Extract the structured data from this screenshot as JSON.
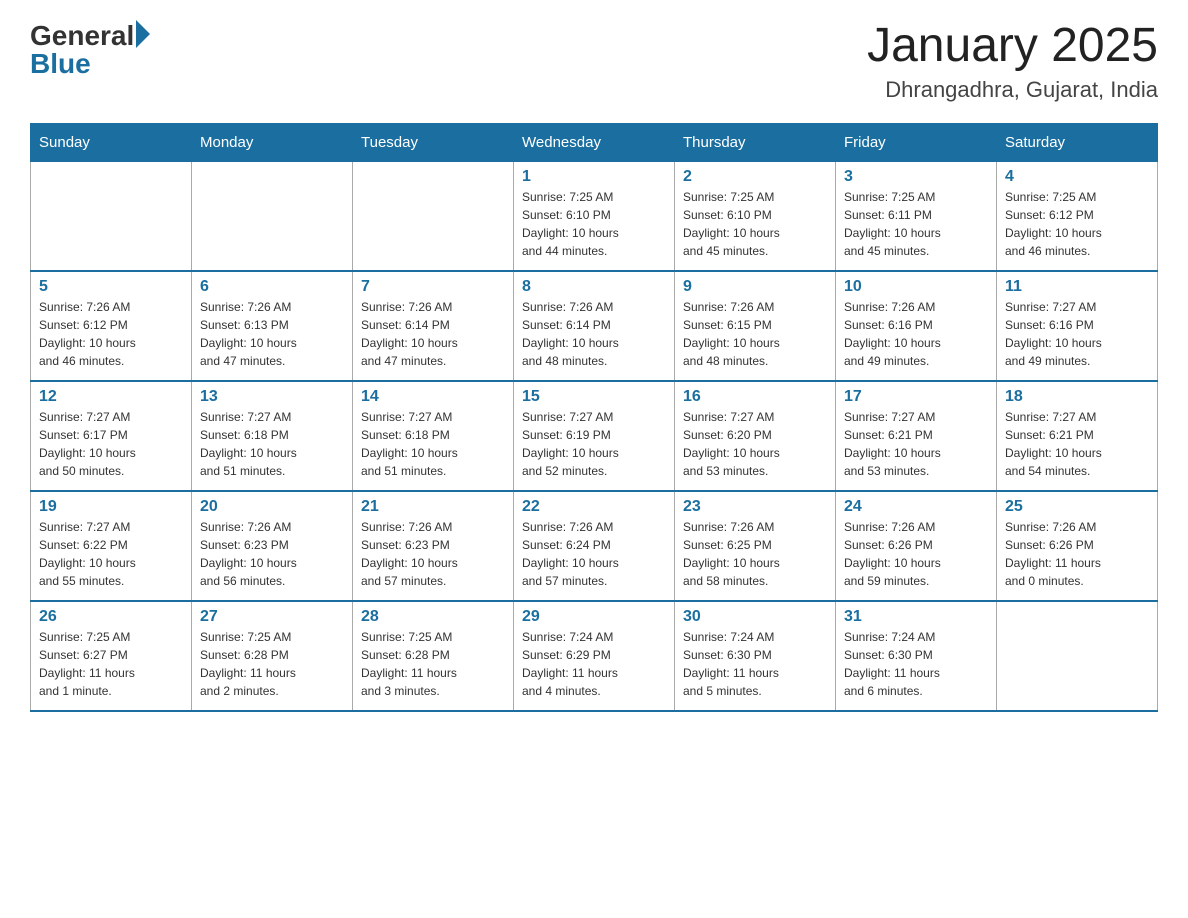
{
  "logo": {
    "general": "General",
    "blue": "Blue"
  },
  "title": "January 2025",
  "subtitle": "Dhrangadhra, Gujarat, India",
  "days_of_week": [
    "Sunday",
    "Monday",
    "Tuesday",
    "Wednesday",
    "Thursday",
    "Friday",
    "Saturday"
  ],
  "weeks": [
    [
      {
        "day": "",
        "info": ""
      },
      {
        "day": "",
        "info": ""
      },
      {
        "day": "",
        "info": ""
      },
      {
        "day": "1",
        "info": "Sunrise: 7:25 AM\nSunset: 6:10 PM\nDaylight: 10 hours\nand 44 minutes."
      },
      {
        "day": "2",
        "info": "Sunrise: 7:25 AM\nSunset: 6:10 PM\nDaylight: 10 hours\nand 45 minutes."
      },
      {
        "day": "3",
        "info": "Sunrise: 7:25 AM\nSunset: 6:11 PM\nDaylight: 10 hours\nand 45 minutes."
      },
      {
        "day": "4",
        "info": "Sunrise: 7:25 AM\nSunset: 6:12 PM\nDaylight: 10 hours\nand 46 minutes."
      }
    ],
    [
      {
        "day": "5",
        "info": "Sunrise: 7:26 AM\nSunset: 6:12 PM\nDaylight: 10 hours\nand 46 minutes."
      },
      {
        "day": "6",
        "info": "Sunrise: 7:26 AM\nSunset: 6:13 PM\nDaylight: 10 hours\nand 47 minutes."
      },
      {
        "day": "7",
        "info": "Sunrise: 7:26 AM\nSunset: 6:14 PM\nDaylight: 10 hours\nand 47 minutes."
      },
      {
        "day": "8",
        "info": "Sunrise: 7:26 AM\nSunset: 6:14 PM\nDaylight: 10 hours\nand 48 minutes."
      },
      {
        "day": "9",
        "info": "Sunrise: 7:26 AM\nSunset: 6:15 PM\nDaylight: 10 hours\nand 48 minutes."
      },
      {
        "day": "10",
        "info": "Sunrise: 7:26 AM\nSunset: 6:16 PM\nDaylight: 10 hours\nand 49 minutes."
      },
      {
        "day": "11",
        "info": "Sunrise: 7:27 AM\nSunset: 6:16 PM\nDaylight: 10 hours\nand 49 minutes."
      }
    ],
    [
      {
        "day": "12",
        "info": "Sunrise: 7:27 AM\nSunset: 6:17 PM\nDaylight: 10 hours\nand 50 minutes."
      },
      {
        "day": "13",
        "info": "Sunrise: 7:27 AM\nSunset: 6:18 PM\nDaylight: 10 hours\nand 51 minutes."
      },
      {
        "day": "14",
        "info": "Sunrise: 7:27 AM\nSunset: 6:18 PM\nDaylight: 10 hours\nand 51 minutes."
      },
      {
        "day": "15",
        "info": "Sunrise: 7:27 AM\nSunset: 6:19 PM\nDaylight: 10 hours\nand 52 minutes."
      },
      {
        "day": "16",
        "info": "Sunrise: 7:27 AM\nSunset: 6:20 PM\nDaylight: 10 hours\nand 53 minutes."
      },
      {
        "day": "17",
        "info": "Sunrise: 7:27 AM\nSunset: 6:21 PM\nDaylight: 10 hours\nand 53 minutes."
      },
      {
        "day": "18",
        "info": "Sunrise: 7:27 AM\nSunset: 6:21 PM\nDaylight: 10 hours\nand 54 minutes."
      }
    ],
    [
      {
        "day": "19",
        "info": "Sunrise: 7:27 AM\nSunset: 6:22 PM\nDaylight: 10 hours\nand 55 minutes."
      },
      {
        "day": "20",
        "info": "Sunrise: 7:26 AM\nSunset: 6:23 PM\nDaylight: 10 hours\nand 56 minutes."
      },
      {
        "day": "21",
        "info": "Sunrise: 7:26 AM\nSunset: 6:23 PM\nDaylight: 10 hours\nand 57 minutes."
      },
      {
        "day": "22",
        "info": "Sunrise: 7:26 AM\nSunset: 6:24 PM\nDaylight: 10 hours\nand 57 minutes."
      },
      {
        "day": "23",
        "info": "Sunrise: 7:26 AM\nSunset: 6:25 PM\nDaylight: 10 hours\nand 58 minutes."
      },
      {
        "day": "24",
        "info": "Sunrise: 7:26 AM\nSunset: 6:26 PM\nDaylight: 10 hours\nand 59 minutes."
      },
      {
        "day": "25",
        "info": "Sunrise: 7:26 AM\nSunset: 6:26 PM\nDaylight: 11 hours\nand 0 minutes."
      }
    ],
    [
      {
        "day": "26",
        "info": "Sunrise: 7:25 AM\nSunset: 6:27 PM\nDaylight: 11 hours\nand 1 minute."
      },
      {
        "day": "27",
        "info": "Sunrise: 7:25 AM\nSunset: 6:28 PM\nDaylight: 11 hours\nand 2 minutes."
      },
      {
        "day": "28",
        "info": "Sunrise: 7:25 AM\nSunset: 6:28 PM\nDaylight: 11 hours\nand 3 minutes."
      },
      {
        "day": "29",
        "info": "Sunrise: 7:24 AM\nSunset: 6:29 PM\nDaylight: 11 hours\nand 4 minutes."
      },
      {
        "day": "30",
        "info": "Sunrise: 7:24 AM\nSunset: 6:30 PM\nDaylight: 11 hours\nand 5 minutes."
      },
      {
        "day": "31",
        "info": "Sunrise: 7:24 AM\nSunset: 6:30 PM\nDaylight: 11 hours\nand 6 minutes."
      },
      {
        "day": "",
        "info": ""
      }
    ]
  ]
}
